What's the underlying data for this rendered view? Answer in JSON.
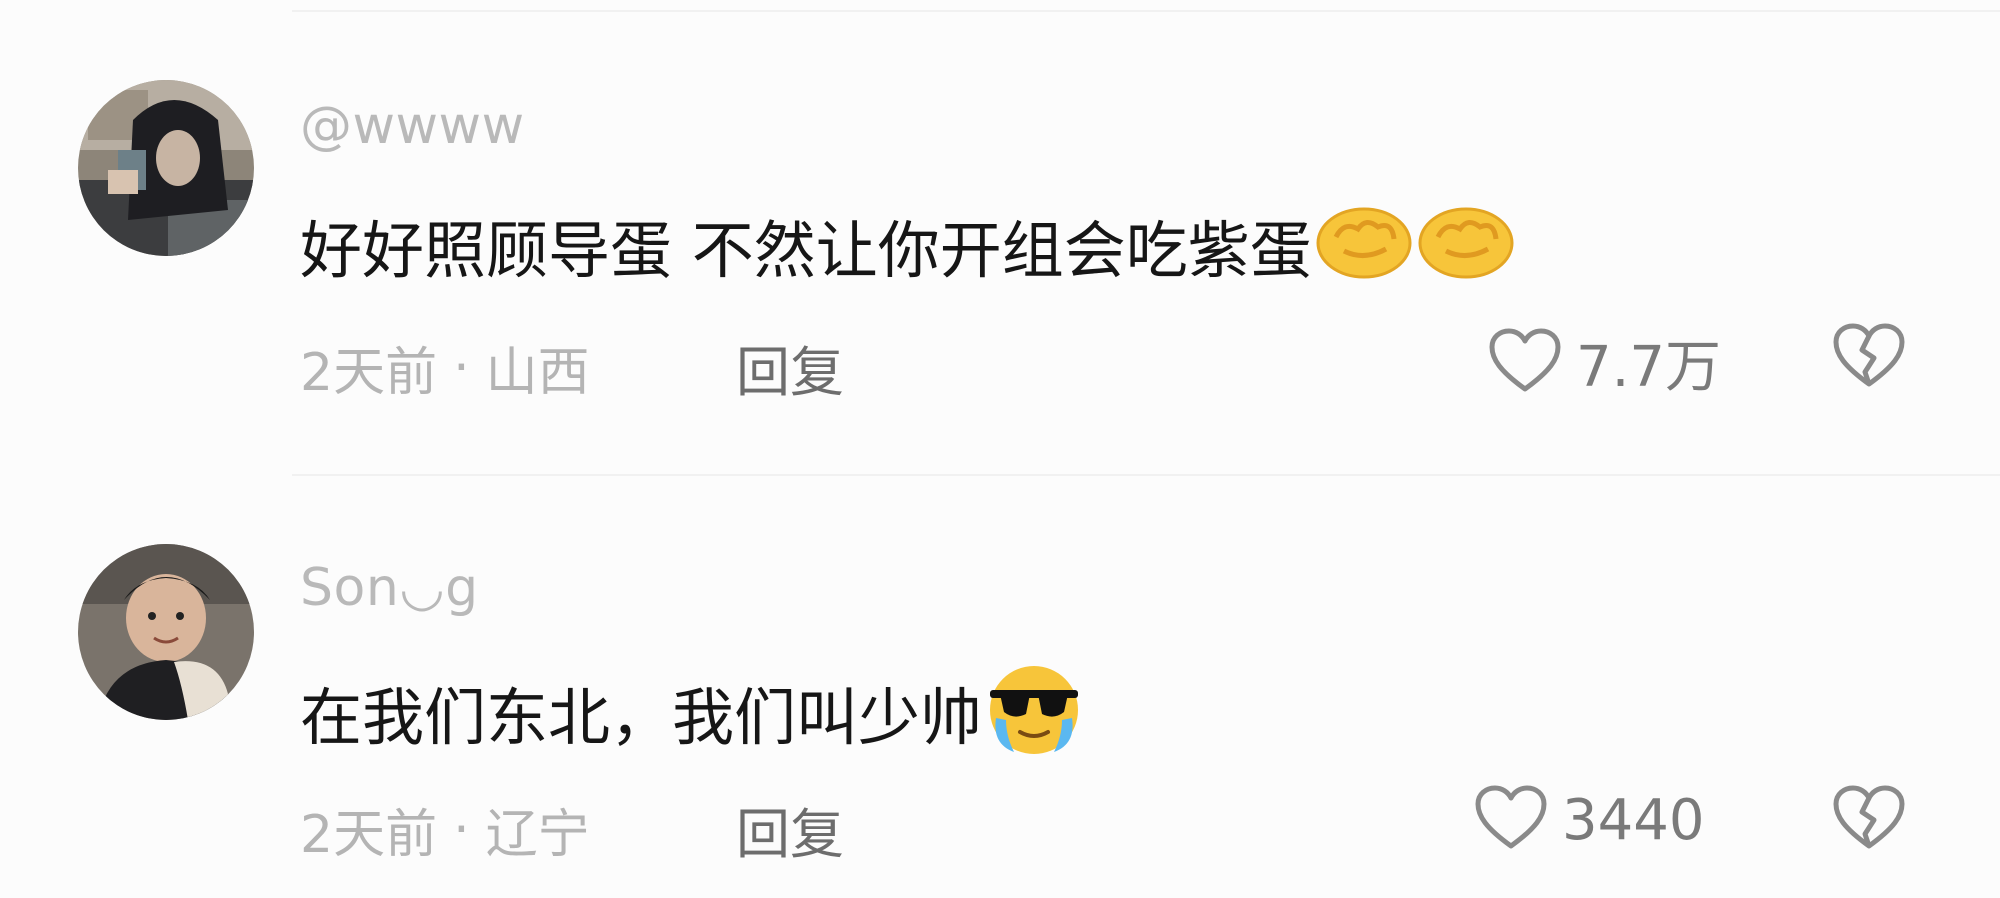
{
  "comments": [
    {
      "username": "@wwww",
      "text": "好好照顾导蛋 不然让你开组会吃紫蛋",
      "emoji": [
        "fist-emoji",
        "fist-emoji"
      ],
      "time": "2天前",
      "dot": "·",
      "location": "山西",
      "reply_label": "回复",
      "likes": "7.7万"
    },
    {
      "username": "Son◡g",
      "text": "在我们东北，我们叫少帅",
      "emoji": [
        "cool-crying-emoji"
      ],
      "time": "2天前",
      "dot": "·",
      "location": "辽宁",
      "reply_label": "回复",
      "likes": "3440"
    }
  ],
  "icons": {
    "like": "heart-outline-icon",
    "dislike": "broken-heart-outline-icon"
  },
  "colors": {
    "username": "#b9b9b9",
    "text": "#161616",
    "meta": "#b4b4b4",
    "reply": "#6d6d6d",
    "icon": "#8a8a8a",
    "emoji_yellow": "#f7c53a"
  }
}
